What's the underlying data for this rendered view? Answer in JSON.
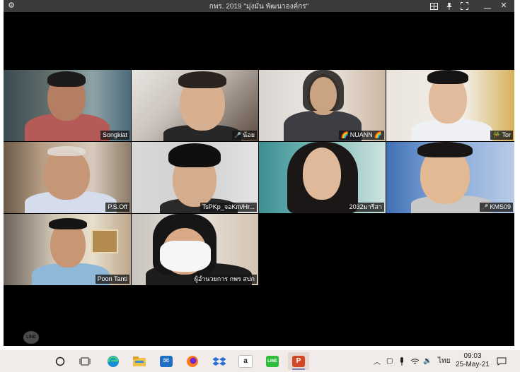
{
  "window": {
    "title": "กพร. 2019 \"มุ่งมั่น พัฒนาองค์กร\"",
    "left_icon": "gear-icon",
    "right_icons": [
      "grid-view-icon",
      "pin-icon",
      "fullscreen-icon",
      "minimize-icon",
      "close-icon"
    ]
  },
  "participants": [
    {
      "name": "Songkiat",
      "muted": false
    },
    {
      "name": "น้อย",
      "muted": true
    },
    {
      "name": "NUANN",
      "muted": false,
      "prefix": "🌈",
      "suffix": "🌈"
    },
    {
      "name": "Tor",
      "muted": false,
      "prefix": "🎋"
    },
    {
      "name": "P.S.Off",
      "muted": false
    },
    {
      "name": "TsPKp_จอKm/Hr...",
      "muted": false
    },
    {
      "name": "2032มารีสา",
      "muted": false
    },
    {
      "name": "KMS09",
      "muted": true
    },
    {
      "name": "Poon Tanti",
      "muted": false
    },
    {
      "name": "ผู้อำนวยการ กพร สปก",
      "muted": false
    }
  ],
  "line_watermark": "LINE",
  "taskbar": {
    "apps": [
      "cortana-icon",
      "task-view-icon",
      "edge-icon",
      "file-explorer-icon",
      "mail-icon",
      "firefox-icon",
      "dropbox-icon",
      "amazon-icon",
      "line-icon",
      "powerpoint-icon"
    ],
    "active_app": "powerpoint-icon",
    "tray": {
      "language": "ไทย"
    },
    "clock": {
      "time": "09:03",
      "date": "25-May-21"
    }
  }
}
